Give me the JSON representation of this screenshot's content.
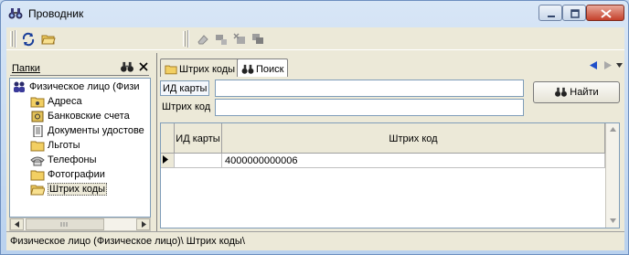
{
  "window": {
    "title": "Проводник",
    "icon": "binoculars-icon"
  },
  "toolbar": {
    "buttons": [
      {
        "name": "refresh-icon",
        "enabled": true
      },
      {
        "name": "open-folder-icon",
        "enabled": true
      },
      {
        "name": "eraser-icon",
        "enabled": false
      },
      {
        "name": "stamp-icon",
        "enabled": false
      },
      {
        "name": "grid-delete-icon",
        "enabled": false
      },
      {
        "name": "copy-icon",
        "enabled": false
      }
    ]
  },
  "left_panel": {
    "title": "Папки",
    "tree": [
      {
        "label": "Физическое лицо (Физи",
        "icon": "person-icon",
        "level": 0
      },
      {
        "label": "Адреса",
        "icon": "folder-icon",
        "level": 1
      },
      {
        "label": "Банковские счета",
        "icon": "safe-icon",
        "level": 1
      },
      {
        "label": "Документы удостове",
        "icon": "document-icon",
        "level": 1
      },
      {
        "label": "Льготы",
        "icon": "folder-icon",
        "level": 1
      },
      {
        "label": "Телефоны",
        "icon": "phone-icon",
        "level": 1
      },
      {
        "label": "Фотографии",
        "icon": "folder-icon",
        "level": 1
      },
      {
        "label": "Штрих коды",
        "icon": "folder-open-icon",
        "level": 1,
        "selected": true
      }
    ]
  },
  "right_panel": {
    "tabs": [
      {
        "label": "Штрих коды",
        "icon": "folder-icon",
        "active": false
      },
      {
        "label": "Поиск",
        "icon": "binoculars-icon",
        "active": true
      }
    ],
    "form": {
      "id_label": "ИД карты",
      "id_value": "",
      "barcode_label": "Штрих код",
      "barcode_value": "",
      "search_button": "Найти"
    },
    "grid": {
      "columns": [
        "ИД карты",
        "Штрих код"
      ],
      "rows": [
        {
          "id": "",
          "barcode": "4000000000006",
          "current": true
        }
      ]
    }
  },
  "statusbar": {
    "path": "Физическое лицо (Физическое лицо)\\ Штрих коды\\"
  },
  "colors": {
    "title_gradient_top": "#d8e6f6",
    "close_button": "#c4402a",
    "face": "#ece9d8",
    "border_blue": "#7f9db9",
    "nav_arrow_blue": "#1f4fc9"
  }
}
